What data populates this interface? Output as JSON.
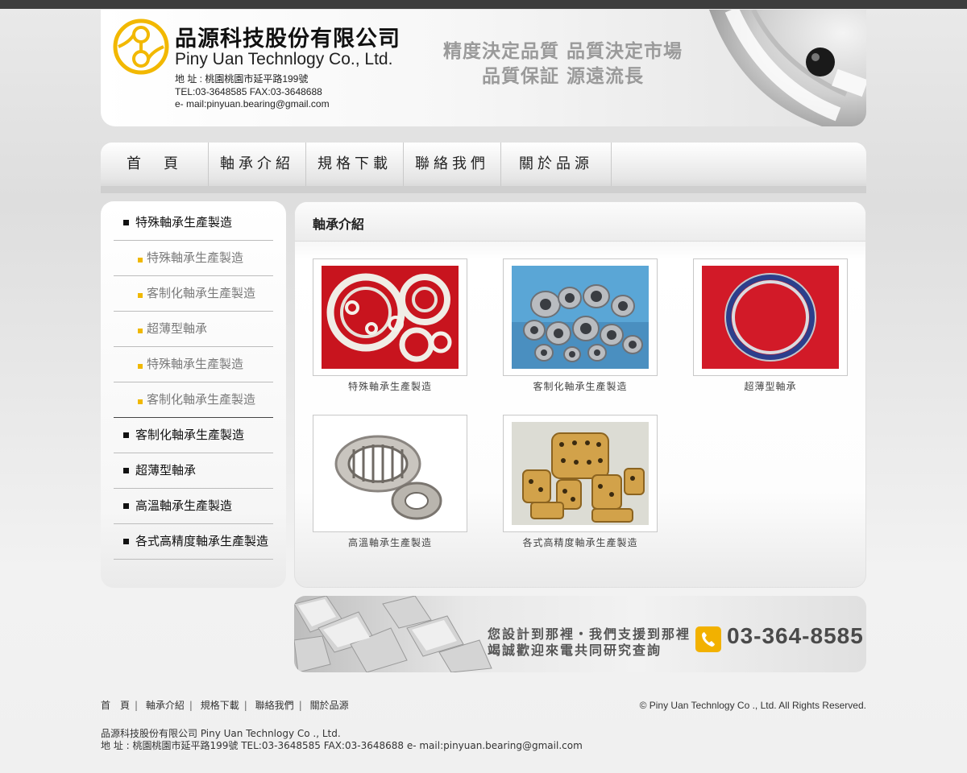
{
  "header": {
    "company_cn": "品源科技股份有限公司",
    "company_en": "Piny Uan Technlogy Co., Ltd.",
    "address": "地 址 : 桃園桃園市延平路199號",
    "tel_fax": "TEL:03-3648585     FAX:03-3648688",
    "email": "e- mail:pinyuan.bearing@gmail.com",
    "slogan_line1": "精度決定品質   品質決定市場",
    "slogan_line2": "品質保証   源遠流長"
  },
  "nav": {
    "items": [
      "首　頁",
      "軸承介紹",
      "規格下載",
      "聯絡我們",
      "關於品源"
    ]
  },
  "sidebar": {
    "items": [
      {
        "label": "特殊軸承生產製造",
        "level": "main"
      },
      {
        "label": "特殊軸承生產製造",
        "level": "sub"
      },
      {
        "label": "客制化軸承生產製造",
        "level": "sub"
      },
      {
        "label": "超薄型軸承",
        "level": "sub"
      },
      {
        "label": "特殊軸承生產製造",
        "level": "sub"
      },
      {
        "label": "客制化軸承生產製造",
        "level": "sub"
      },
      {
        "label": "客制化軸承生產製造",
        "level": "main"
      },
      {
        "label": "超薄型軸承",
        "level": "main"
      },
      {
        "label": "高溫軸承生產製造",
        "level": "main"
      },
      {
        "label": "各式高精度軸承生產製造",
        "level": "main"
      }
    ]
  },
  "content": {
    "title": "軸承介紹",
    "products": [
      {
        "caption": "特殊軸承生產製造"
      },
      {
        "caption": "客制化軸承生產製造"
      },
      {
        "caption": "超薄型軸承"
      },
      {
        "caption": "高溫軸承生產製造"
      },
      {
        "caption": "各式高精度軸承生產製造"
      }
    ]
  },
  "banner": {
    "line1": "您設計到那裡・我們支援到那裡",
    "line2": "竭誠歡迎來電共同研究查詢",
    "phone": "03-364-8585"
  },
  "footer": {
    "links": [
      "首　頁",
      "軸承介紹",
      "規格下載",
      "聯絡我們",
      "關於品源"
    ],
    "copyright": "©  Piny Uan Technlogy Co ., Ltd. All Rights Reserved.",
    "company_line": "品源科技股份有限公司    Piny Uan Technlogy Co ., Ltd.",
    "address_line": "地 址 : 桃園桃園市延平路199號     TEL:03-3648585      FAX:03-3648688      e- mail:pinyuan.bearing@gmail.com"
  },
  "colors": {
    "accent": "#f0b800",
    "topbar": "#3d3d3d",
    "page_bg": "#efefef"
  }
}
